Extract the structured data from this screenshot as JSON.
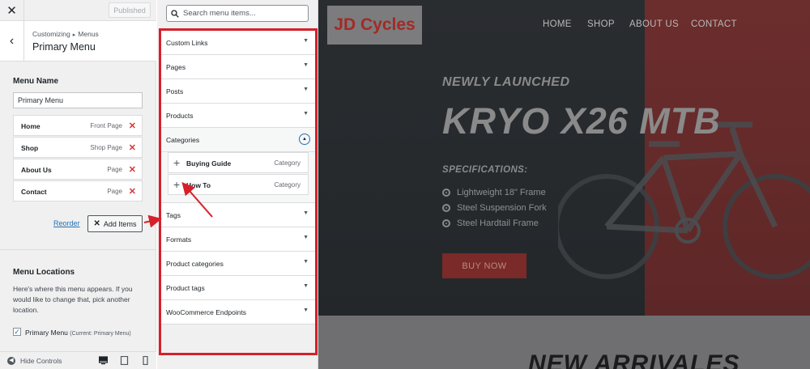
{
  "sidebar": {
    "close_glyph": "✕",
    "published_label": "Published",
    "back_glyph": "‹",
    "breadcrumb": {
      "parent": "Customizing",
      "child": "Menus"
    },
    "title": "Primary Menu",
    "menu_name_label": "Menu Name",
    "menu_name_value": "Primary Menu",
    "menu_items": [
      {
        "title": "Home",
        "type": "Front Page"
      },
      {
        "title": "Shop",
        "type": "Shop Page"
      },
      {
        "title": "About Us",
        "type": "Page"
      },
      {
        "title": "Contact",
        "type": "Page"
      }
    ],
    "reorder_label": "Reorder",
    "add_items_label": "Add Items",
    "locations_title": "Menu Locations",
    "locations_desc": "Here's where this menu appears. If you would like to change that, pick another location.",
    "location_option": {
      "label": "Primary Menu",
      "current": "(Current: Primary Menu)",
      "checked": true
    },
    "hide_controls_label": "Hide Controls"
  },
  "panel": {
    "search_placeholder": "Search menu items...",
    "sections": [
      {
        "label": "Custom Links",
        "open": false
      },
      {
        "label": "Pages",
        "open": false
      },
      {
        "label": "Posts",
        "open": false
      },
      {
        "label": "Products",
        "open": false
      },
      {
        "label": "Categories",
        "open": true
      },
      {
        "label": "Tags",
        "open": false
      },
      {
        "label": "Formats",
        "open": false
      },
      {
        "label": "Product categories",
        "open": false
      },
      {
        "label": "Product tags",
        "open": false
      },
      {
        "label": "WooCommerce Endpoints",
        "open": false
      }
    ],
    "category_items": [
      {
        "title": "Buying Guide",
        "type": "Category"
      },
      {
        "title": "How To",
        "type": "Category"
      }
    ]
  },
  "preview": {
    "logo": "JD Cycles",
    "nav": [
      "HOME",
      "SHOP",
      "ABOUT US",
      "CONTACT"
    ],
    "subtitle": "NEWLY LAUNCHED",
    "title": "KRYO X26 MTB",
    "spec_title": "SPECIFICATIONS:",
    "specs": [
      "Lightweight 18\" Frame",
      "Steel Suspension Fork",
      "Steel Hardtail Frame"
    ],
    "buy_label": "BUY NOW",
    "section_heading": "NEW ARRIVALES"
  },
  "colors": {
    "highlight": "#d6202a",
    "remove": "#d63638",
    "link": "#2271b1",
    "brand_red": "#a32a25"
  }
}
